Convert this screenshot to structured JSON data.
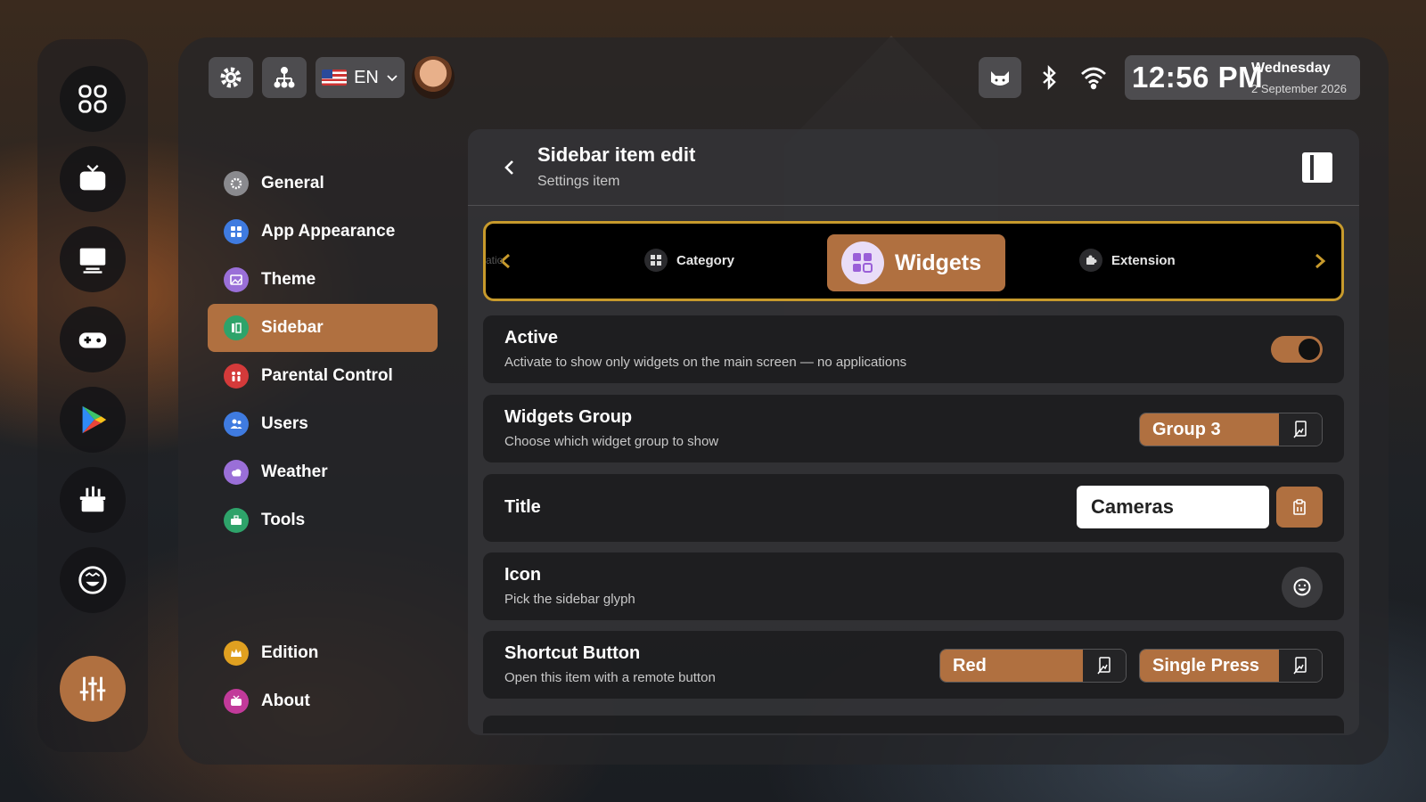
{
  "topbar": {
    "language": "EN",
    "clock": {
      "time": "12:56 PM",
      "day": "Wednesday",
      "date": "2 September 2026"
    }
  },
  "rail": {
    "items": [
      {
        "icon": "apps-grid-icon"
      },
      {
        "icon": "tv-icon"
      },
      {
        "icon": "monitor-icon"
      },
      {
        "icon": "gamepad-icon"
      },
      {
        "icon": "play-store-icon"
      },
      {
        "icon": "toolbox-icon"
      },
      {
        "icon": "smiley-icon"
      },
      {
        "icon": "sliders-icon",
        "active": true
      }
    ]
  },
  "menu": {
    "items": [
      {
        "label": "General",
        "icon": "gear-icon",
        "color": "#8a8a8e"
      },
      {
        "label": "App Appearance",
        "icon": "grid-icon",
        "color": "#3f7be0"
      },
      {
        "label": "Theme",
        "icon": "image-icon",
        "color": "#9a6fd8"
      },
      {
        "label": "Sidebar",
        "icon": "sidebar-icon",
        "color": "#2ea36a",
        "active": true
      },
      {
        "label": "Parental Control",
        "icon": "family-icon",
        "color": "#d43a3a"
      },
      {
        "label": "Users",
        "icon": "users-icon",
        "color": "#3f7be0"
      },
      {
        "label": "Weather",
        "icon": "cloud-icon",
        "color": "#9a6fd8"
      },
      {
        "label": "Tools",
        "icon": "toolbox-icon",
        "color": "#2ea36a"
      }
    ],
    "bottom": [
      {
        "label": "Edition",
        "icon": "crown-icon",
        "color": "#e0a020"
      },
      {
        "label": "About",
        "icon": "tv-icon",
        "color": "#c23a9a"
      }
    ]
  },
  "content": {
    "title": "Sidebar item edit",
    "subtitle": "Settings item",
    "carousel": {
      "items": [
        "Category",
        "Widgets",
        "Extension"
      ],
      "ghost_left": "atio",
      "selected": "Widgets"
    },
    "rows": {
      "active": {
        "title": "Active",
        "subtitle": "Activate to show only widgets on the main screen — no applications",
        "value": true
      },
      "group": {
        "title": "Widgets Group",
        "subtitle": "Choose which widget group to show",
        "value": "Group 3"
      },
      "title": {
        "title": "Title",
        "value": "Cameras"
      },
      "icon": {
        "title": "Icon",
        "subtitle": "Pick the sidebar glyph"
      },
      "shortcut": {
        "title": "Shortcut Button",
        "subtitle": "Open this item with a remote button",
        "button": "Red",
        "press": "Single Press"
      }
    }
  },
  "colors": {
    "accent": "#b07040",
    "carousel_border": "#c79a2c"
  }
}
